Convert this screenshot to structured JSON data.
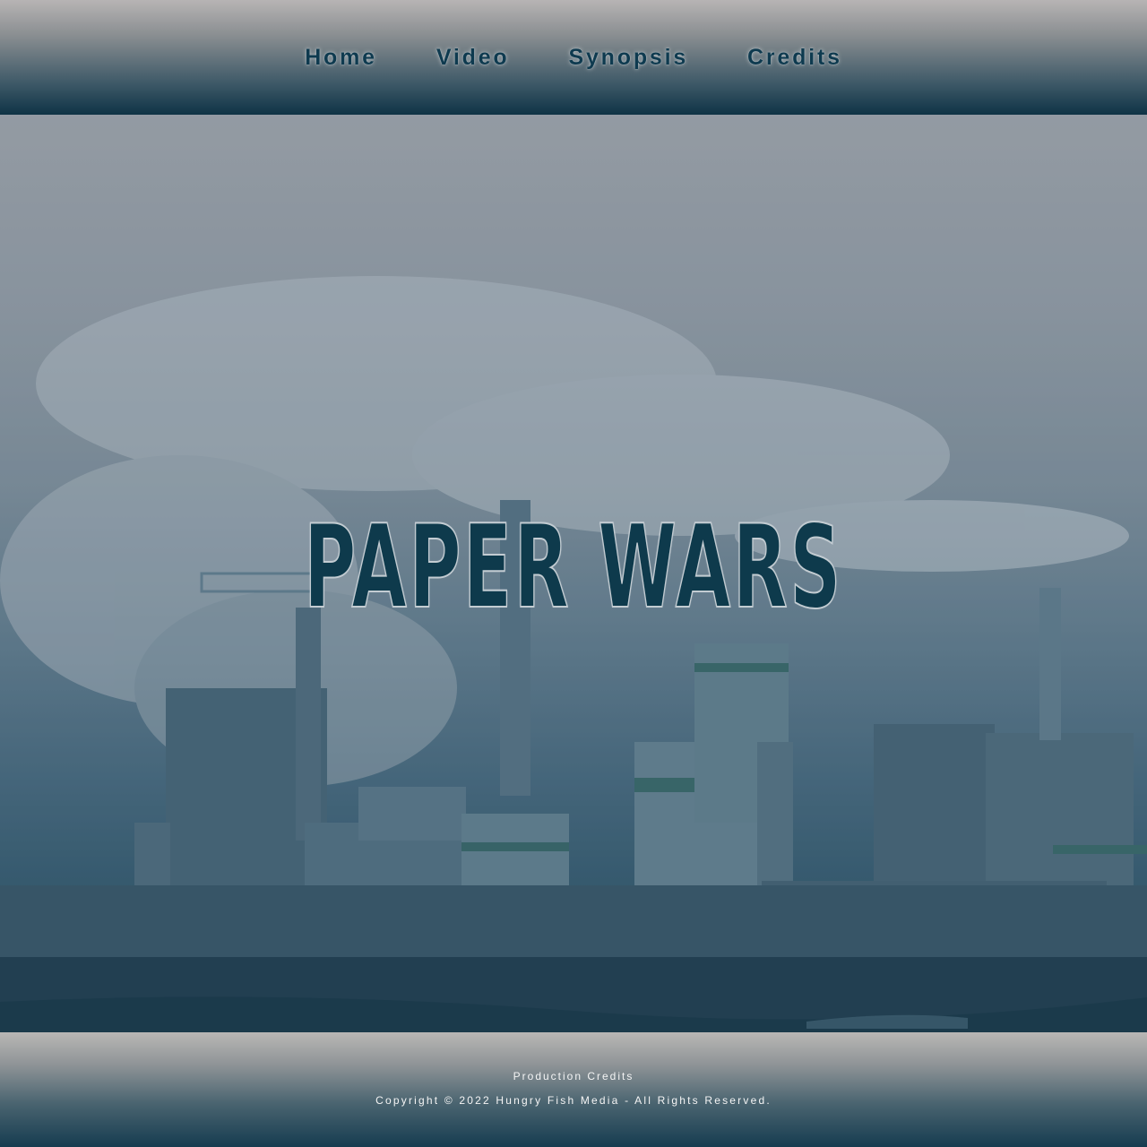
{
  "nav": {
    "items": [
      {
        "label": "Home"
      },
      {
        "label": "Video"
      },
      {
        "label": "Synopsis"
      },
      {
        "label": "Credits"
      }
    ]
  },
  "hero": {
    "title": "PAPER WARS",
    "image": "smoking-paper-mill-photo"
  },
  "footer": {
    "link_label": "Production Credits",
    "copyright": "Copyright © 2022 Hungry Fish Media - All Rights Reserved."
  },
  "colors": {
    "accent": "#0e3a4f",
    "header_bottom": "#0f3346",
    "footer_text": "#f4f4f4"
  }
}
